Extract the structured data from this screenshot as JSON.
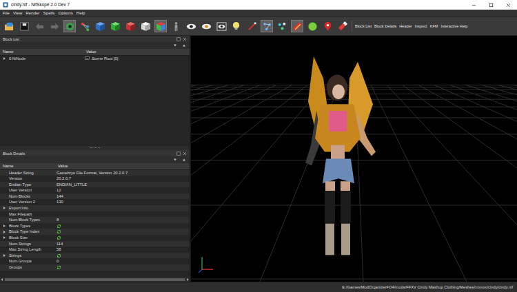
{
  "window": {
    "title": "cindy.nif - NifSkope 2.0 Dev 7"
  },
  "menu": [
    "File",
    "View",
    "Render",
    "Spells",
    "Options",
    "Help"
  ],
  "toolbar": {
    "tools": [
      {
        "selected": false
      },
      {
        "selected": false
      },
      {
        "selected": false
      },
      {
        "selected": false
      },
      {
        "selected": true
      },
      {
        "selected": false
      },
      {
        "selected": false
      },
      {
        "selected": false
      },
      {
        "selected": false
      },
      {
        "selected": false
      },
      {
        "selected": true
      },
      {
        "selected": false
      },
      {
        "selected": false
      },
      {
        "selected": false
      },
      {
        "selected": false
      },
      {
        "selected": false
      },
      {
        "selected": false
      },
      {
        "selected": true
      },
      {
        "selected": false
      },
      {
        "selected": true
      },
      {
        "selected": false
      },
      {
        "selected": false
      },
      {
        "selected": false
      }
    ],
    "links": [
      "Block List",
      "Block Details",
      "Header",
      "Inspect",
      "KFM",
      "Interactive Help"
    ]
  },
  "block_list": {
    "title": "Block List",
    "columns": [
      "Name",
      "Value"
    ],
    "rows": [
      {
        "name": "0 NiNode",
        "value": "Scene Root [0]",
        "expandable": true,
        "expanded": false
      }
    ]
  },
  "block_details": {
    "title": "Block Details",
    "columns": [
      "Name",
      "Value"
    ],
    "rows": [
      {
        "name": "Header String",
        "value": "Gamebryo File Format, Version 20.2.0.7",
        "kind": "text",
        "expandable": false,
        "expanded": false
      },
      {
        "name": "Version",
        "value": "20.2.0.7",
        "kind": "text",
        "expandable": false,
        "expanded": false
      },
      {
        "name": "Endian Type",
        "value": "ENDIAN_LITTLE",
        "kind": "text",
        "expandable": false,
        "expanded": false
      },
      {
        "name": "User Version",
        "value": "12",
        "kind": "text",
        "expandable": false,
        "expanded": false
      },
      {
        "name": "Num Blocks",
        "value": "144",
        "kind": "text",
        "expandable": false,
        "expanded": false
      },
      {
        "name": "User Version 2",
        "value": "130",
        "kind": "text",
        "expandable": false,
        "expanded": false
      },
      {
        "name": "Export Info",
        "value": "",
        "kind": "text",
        "expandable": true,
        "expanded": false
      },
      {
        "name": "Max Filepath",
        "value": "",
        "kind": "text",
        "expandable": false,
        "expanded": false
      },
      {
        "name": "Num Block Types",
        "value": "8",
        "kind": "text",
        "expandable": false,
        "expanded": false
      },
      {
        "name": "Block Types",
        "value": "",
        "kind": "array",
        "expandable": true,
        "expanded": false
      },
      {
        "name": "Block Type Index",
        "value": "",
        "kind": "array",
        "expandable": true,
        "expanded": false
      },
      {
        "name": "Block Size",
        "value": "",
        "kind": "array",
        "expandable": true,
        "expanded": false
      },
      {
        "name": "Num Strings",
        "value": "114",
        "kind": "text",
        "expandable": false,
        "expanded": false
      },
      {
        "name": "Max String Length",
        "value": "58",
        "kind": "text",
        "expandable": false,
        "expanded": false
      },
      {
        "name": "Strings",
        "value": "",
        "kind": "array",
        "expandable": true,
        "expanded": false
      },
      {
        "name": "Num Groups",
        "value": "0",
        "kind": "text",
        "expandable": false,
        "expanded": false
      },
      {
        "name": "Groups",
        "value": "",
        "kind": "array",
        "expandable": false,
        "expanded": false
      }
    ]
  },
  "status_bar": {
    "path": "E:/Games/ModOrganizerFO4/mods/FFXV Cindy Mashup Clothing/Meshes/xxxvxx/cindy/cindy.nif"
  }
}
